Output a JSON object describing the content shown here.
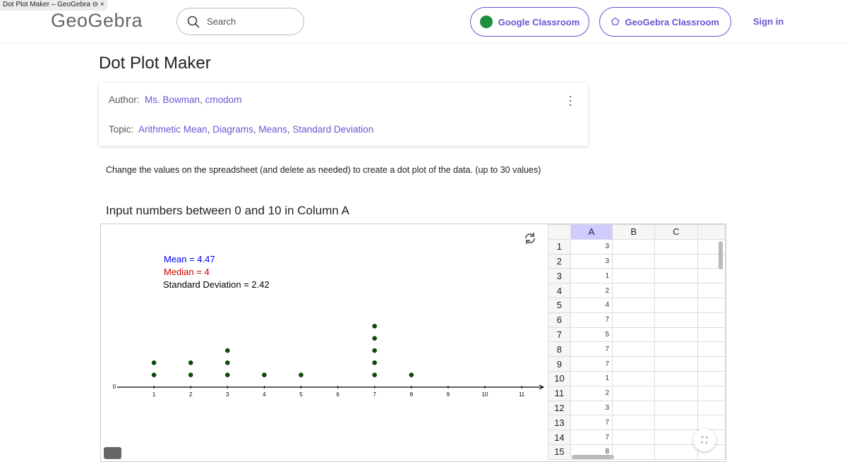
{
  "browser_tab": {
    "title": "Dot Plot Maker – GeoGebra"
  },
  "header": {
    "logo": "GeoGebra",
    "search_placeholder": "Search",
    "google_classroom": "Google Classroom",
    "geogebra_classroom": "GeoGebra Classroom",
    "sign_in": "Sign in"
  },
  "page": {
    "title": "Dot Plot Maker",
    "author_label": "Author:",
    "authors": [
      "Ms. Bowman",
      "cmodom"
    ],
    "topic_label": "Topic:",
    "topics": [
      "Arithmetic Mean",
      "Diagrams",
      "Means",
      "Standard Deviation"
    ],
    "description": "Change the values on the spreadsheet (and delete as needed) to create a dot plot of the data. (up to 30 values)",
    "subtitle": "Input numbers between 0 and 10 in Column A"
  },
  "stats": {
    "mean": "Mean = 4.47",
    "median": "Median = 4",
    "sd": "Standard Deviation = 2.42",
    "mean_color": "#0000ff",
    "median_color": "#cc0000"
  },
  "chart_data": {
    "type": "scatter",
    "title": "",
    "xlabel": "",
    "ylabel": "",
    "xlim": [
      0,
      11.5
    ],
    "x_ticks": [
      0,
      1,
      2,
      3,
      4,
      5,
      6,
      7,
      8,
      9,
      10,
      11
    ],
    "values": [
      3,
      3,
      1,
      2,
      4,
      7,
      5,
      7,
      7,
      1,
      2,
      3,
      7,
      7,
      8
    ],
    "dot_color": "#005500",
    "grid": false
  },
  "spreadsheet": {
    "columns": [
      "A",
      "B",
      "C"
    ],
    "rows": [
      "1",
      "2",
      "3",
      "4",
      "5",
      "6",
      "7",
      "8",
      "9",
      "10",
      "11",
      "12",
      "13",
      "14",
      "15"
    ],
    "column_a": [
      "3",
      "3",
      "1",
      "2",
      "4",
      "7",
      "5",
      "7",
      "7",
      "1",
      "2",
      "3",
      "7",
      "7",
      "8"
    ]
  }
}
